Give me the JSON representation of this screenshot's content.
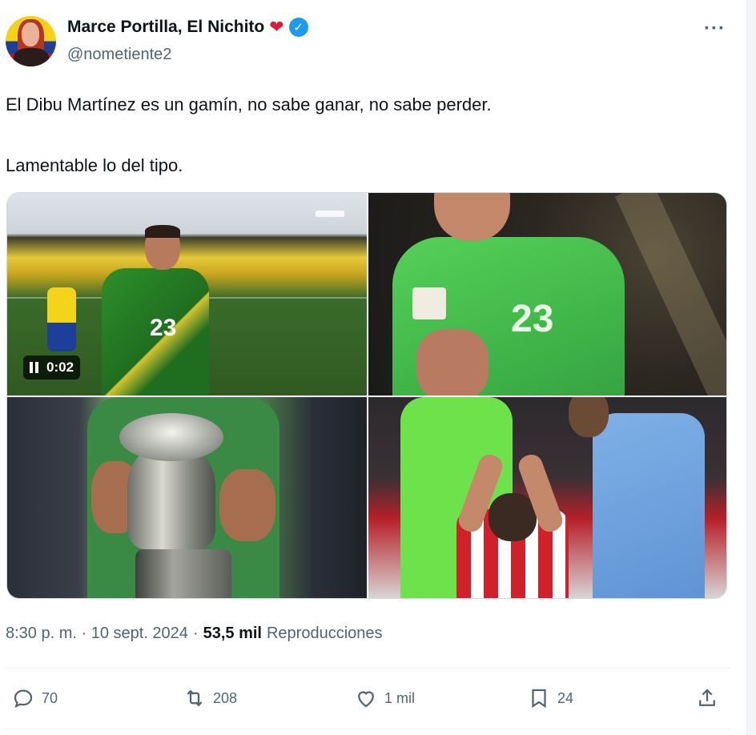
{
  "author": {
    "display_name": "Marce Portilla, El Nichito",
    "name_emoji": "❤",
    "handle": "@nometiente2",
    "verified": true
  },
  "tweet": {
    "lines": [
      "El Dibu Martínez es un gamín, no sabe ganar, no sabe perder.",
      "Lamentable lo del tipo."
    ]
  },
  "media": {
    "video_time": "0:02",
    "cells": [
      {
        "jersey_number": "23"
      },
      {
        "jersey_number": "23"
      }
    ]
  },
  "meta": {
    "timestamp": "8:30 p. m. · 10 sept. 2024",
    "separator": "·",
    "views_count": "53,5 mil",
    "views_label": "Reproducciones"
  },
  "actions": {
    "replies": "70",
    "reposts": "208",
    "likes": "1 mil",
    "bookmarks": "24"
  },
  "colors": {
    "text": "#0f1419",
    "secondary": "#536471",
    "verified": "#1d9bf0",
    "heart": "#d81e3a"
  }
}
